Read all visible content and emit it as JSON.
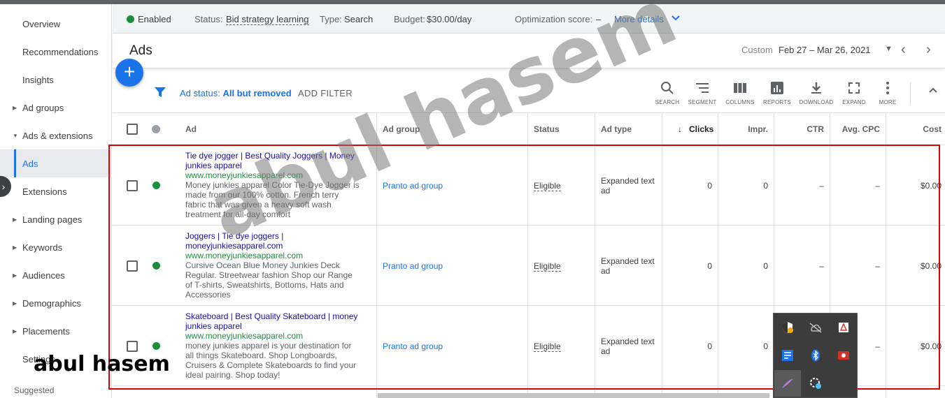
{
  "sidebar": {
    "items": [
      {
        "label": "Overview"
      },
      {
        "label": "Recommendations"
      },
      {
        "label": "Insights"
      },
      {
        "label": "Ad groups"
      },
      {
        "label": "Ads & extensions"
      },
      {
        "label": "Ads"
      },
      {
        "label": "Extensions"
      },
      {
        "label": "Landing pages"
      },
      {
        "label": "Keywords"
      },
      {
        "label": "Audiences"
      },
      {
        "label": "Demographics"
      },
      {
        "label": "Placements"
      },
      {
        "label": "Settings"
      }
    ],
    "suggested": "Suggested"
  },
  "status_bar": {
    "enabled": "Enabled",
    "status_label": "Status:",
    "status_value": "Bid strategy learning",
    "type_label": "Type:",
    "type_value": "Search",
    "budget_label": "Budget:",
    "budget_value": "$30.00/day",
    "opt_label": "Optimization score:",
    "opt_value": "–",
    "more_details": "More details"
  },
  "header": {
    "title": "Ads",
    "date_custom": "Custom",
    "date_range": "Feb 27 – Mar 26, 2021"
  },
  "filter": {
    "ad_status_label": "Ad status:",
    "ad_status_value": "All but removed",
    "add_filter": "ADD FILTER"
  },
  "toolbar": {
    "search": "SEARCH",
    "segment": "SEGMENT",
    "columns": "COLUMNS",
    "reports": "REPORTS",
    "download": "DOWNLOAD",
    "expand": "EXPAND",
    "more": "MORE"
  },
  "table": {
    "headers": {
      "ad": "Ad",
      "ad_group": "Ad group",
      "status": "Status",
      "ad_type": "Ad type",
      "clicks": "Clicks",
      "impr": "Impr.",
      "ctr": "CTR",
      "avg_cpc": "Avg. CPC",
      "cost": "Cost"
    },
    "rows": [
      {
        "headline": "Tie dye jogger | Best Quality Joggers | Money junkies apparel",
        "url": "www.moneyjunkiesapparel.com",
        "desc": "Money junkies apparel Color Tie-Dye Jogger is made from our 100% cotton. French terry fabric that was given a heavy soft wash treatment for all-day comfort",
        "ad_group": "Pranto ad group",
        "status": "Eligible",
        "ad_type": "Expanded text ad",
        "clicks": "0",
        "impr": "0",
        "ctr": "–",
        "avg_cpc": "–",
        "cost": "$0.00"
      },
      {
        "headline": "Joggers | Tie dye joggers | moneyjunkiesapparel.com",
        "url": "www.moneyjunkiesapparel.com",
        "desc": "Cursive Ocean Blue Money Junkies Deck Regular. Streetwear fashion Shop our Range of T-shirts, Sweatshirts, Bottoms, Hats and Accessories",
        "ad_group": "Pranto ad group",
        "status": "Eligible",
        "ad_type": "Expanded text ad",
        "clicks": "0",
        "impr": "0",
        "ctr": "–",
        "avg_cpc": "–",
        "cost": "$0.00"
      },
      {
        "headline": "Skateboard | Best Quality Skateboard | money junkies apparel",
        "url": "www.moneyjunkiesapparel.com",
        "desc": "money junkies apparel is your destination for all things Skateboard. Shop Longboards, Cruisers & Complete Skateboards to find your ideal pairing. Shop today!",
        "ad_group": "Pranto ad group",
        "status": "Eligible",
        "ad_type": "Expanded text ad",
        "clicks": "0",
        "impr": "0",
        "ctr": "–",
        "avg_cpc": "–",
        "cost": "$0.00"
      }
    ]
  },
  "overlay": {
    "watermark": "abul hasem",
    "signature": "abul hasem"
  },
  "colors": {
    "accent": "#1a73e8",
    "enabled_green": "#1e8e3e",
    "highlight_red": "#e00000"
  }
}
